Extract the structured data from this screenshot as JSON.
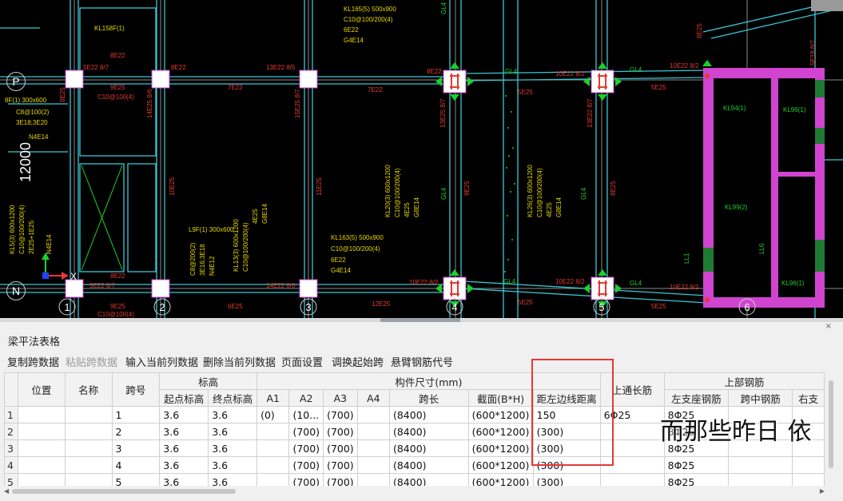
{
  "cad": {
    "axis_labels": {
      "P": "P",
      "N": "N",
      "c2": "2",
      "c3": "3",
      "c4": "4",
      "c5": "5",
      "c6": "6",
      "c1": "1"
    },
    "dimension": "12000",
    "labels": {
      "kl158": "KL158F(1)",
      "kl165": "KL165(5) 500x900",
      "kl165_2": "C10@100/200(4)",
      "kl165_3": "6E22",
      "kl165_4": "G4E14",
      "r8e22a": "8E22",
      "r5e22": "5E22 8/7",
      "r8e22b": "8E22",
      "r13e22": "13E22 8/5",
      "r9e25": "9E25",
      "rc10": "C10@100(4)",
      "r7e22": "7E22",
      "r14e25": "14E25 8/6",
      "r15e25": "15E25 8/7",
      "r8e22c": "8E22",
      "r8e22d": "8E22",
      "gl4a": "GL4",
      "r10e22": "10E22 8/2",
      "gl4b": "GL4",
      "r10e22b": "10E22 8/2",
      "r5e25": "5E25",
      "r5e25b": "5E25",
      "r13e25": "13E25 8/7",
      "r9e25b": "9E25",
      "r13e22b": "13E22 8/7",
      "r9e25c": "9E25",
      "kl94": "KL94(1)",
      "kl96": "KL96(1)",
      "kl99": "KL99(2)",
      "ll6": "LL6",
      "ll1": "LL1",
      "kl96b": "KL96(1)",
      "left1": "8F(1) 300x600",
      "left2": "C8@100(2)",
      "left3": "3E18;3E20",
      "left4": "N4E14",
      "kl13": "KL13(3) 600x1200",
      "kl13b": "C10@100/200(4)",
      "kl13c": "4E25",
      "kl13d": "G8E14",
      "l9": "L9F(1) 300x600",
      "l9b": "C8@200(2)",
      "l9c": "3E16;3E18",
      "l9d": "N4E12",
      "kl163": "KL163(5) 500x900",
      "kl163b": "C10@100/200(4)",
      "kl163c": "6E22",
      "kl163d": "G4E14",
      "kl20": "KL20(3) 600x1200",
      "kl20b": "C10@100/200(4)",
      "kl20c": "4E25",
      "kl20d": "G8E14",
      "kl26": "KL26(3) 600x1200",
      "kl26b": "C10@100/200(4)",
      "kl26c": "4E25",
      "kl26d": "G8E14",
      "r10e25": "10E25",
      "r11e25": "11E25",
      "r9e25d": "9E25",
      "r8e25": "8E25",
      "r5e22b": "5E22 8/7",
      "r14e22": "14E22 8/6",
      "r9e25e": "9E25",
      "r6e25": "6E25",
      "r12e25": "12E25",
      "r10e22c": "10E22 8/2",
      "gl4c": "GL4",
      "r10e22d": "10E22 8/2",
      "gl4d": "GL4",
      "r10e22e": "10E22 8/2",
      "r5e25c": "5E25",
      "r5e25d": "5E25",
      "c10": "C10@100(4)",
      "r8e25b": "8E25",
      "r8e25c": "8E25",
      "r5e18": "5E18 8/7",
      "gl4e": "GL4",
      "gl4f": "GL4",
      "kl5": "KL5(3) 600x1200",
      "kl5b": "C10@100/200(4)",
      "kl5c": "2E25+1E25",
      "n4e14": "N4E14"
    }
  },
  "panel": {
    "title": "梁平法表格",
    "close": "×",
    "toolbar": [
      {
        "label": "复制跨数据",
        "enabled": true
      },
      {
        "label": "粘贴跨数据",
        "enabled": false
      },
      {
        "label": "输入当前列数据",
        "enabled": true
      },
      {
        "label": "删除当前列数据",
        "enabled": true
      },
      {
        "label": "页面设置",
        "enabled": true
      },
      {
        "label": "调换起始跨",
        "enabled": true
      },
      {
        "label": "悬臂钢筋代号",
        "enabled": true
      }
    ],
    "headers": {
      "position": "位置",
      "name": "名称",
      "span": "跨号",
      "elevation": "标高",
      "start_elev": "起点标高",
      "end_elev": "终点标高",
      "size": "构件尺寸(mm)",
      "a1": "A1",
      "a2": "A2",
      "a3": "A3",
      "a4": "A4",
      "span_len": "跨长",
      "section": "截面(B*H)",
      "left_edge": "距左边线距离",
      "top_long": "上通长筋",
      "top_rebar": "上部钢筋",
      "left_support": "左支座钢筋",
      "mid_span": "跨中钢筋",
      "right_support": "右支"
    },
    "rows": [
      {
        "rn": "1",
        "position": "",
        "name": "",
        "span": "1",
        "start": "3.6",
        "end": "3.6",
        "a1": "(0)",
        "a2": "(10...",
        "a3": "(700)",
        "a4": "",
        "len": "(8400)",
        "section": "(600*1200)",
        "left_edge": "150",
        "top_long": "6Φ25",
        "left_support": "8Φ25",
        "mid": "",
        "right": ""
      },
      {
        "rn": "2",
        "position": "",
        "name": "",
        "span": "2",
        "start": "3.6",
        "end": "3.6",
        "a1": "",
        "a2": "(700)",
        "a3": "(700)",
        "a4": "",
        "len": "(8400)",
        "section": "(600*1200)",
        "left_edge": "(300)",
        "top_long": "",
        "left_support": "8Φ25",
        "mid": "",
        "right": ""
      },
      {
        "rn": "3",
        "position": "",
        "name": "",
        "span": "3",
        "start": "3.6",
        "end": "3.6",
        "a1": "",
        "a2": "(700)",
        "a3": "(700)",
        "a4": "",
        "len": "(8400)",
        "section": "(600*1200)",
        "left_edge": "(300)",
        "top_long": "",
        "left_support": "8Φ25",
        "mid": "",
        "right": ""
      },
      {
        "rn": "4",
        "position": "",
        "name": "",
        "span": "4",
        "start": "3.6",
        "end": "3.6",
        "a1": "",
        "a2": "(700)",
        "a3": "(700)",
        "a4": "",
        "len": "(8400)",
        "section": "(600*1200)",
        "left_edge": "(300)",
        "top_long": "",
        "left_support": "8Φ25",
        "mid": "",
        "right": ""
      },
      {
        "rn": "5",
        "position": "",
        "name": "",
        "span": "5",
        "start": "3.6",
        "end": "3.6",
        "a1": "",
        "a2": "(700)",
        "a3": "(700)",
        "a4": "",
        "len": "(8400)",
        "section": "(600*1200)",
        "left_edge": "(300)",
        "top_long": "",
        "left_support": "8Φ25",
        "mid": "",
        "right": ""
      }
    ]
  },
  "overlay_text": "而那些昨日 依",
  "colors": {
    "cad_bg": "#000000",
    "cyan": "#38c8d8",
    "yellow": "#e8d800",
    "green": "#19d22b",
    "magenta": "#d044d0",
    "red_box": "#e53935"
  }
}
